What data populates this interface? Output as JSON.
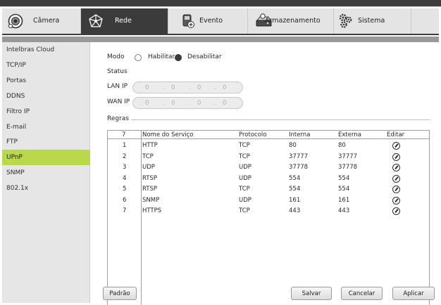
{
  "tabs": [
    {
      "label": "Câmera",
      "icon": "camera-icon"
    },
    {
      "label": "Rede",
      "icon": "network-icon",
      "active": true
    },
    {
      "label": "Evento",
      "icon": "event-icon"
    },
    {
      "label": "Armazenamento",
      "icon": "storage-icon"
    },
    {
      "label": "Sistema",
      "icon": "gears-icon"
    }
  ],
  "sidebar": {
    "items": [
      {
        "label": "Intelbras Cloud"
      },
      {
        "label": "TCP/IP"
      },
      {
        "label": "Portas"
      },
      {
        "label": "DDNS"
      },
      {
        "label": "Filtro IP"
      },
      {
        "label": "E-mail"
      },
      {
        "label": "FTP"
      },
      {
        "label": "UPnP",
        "active": true
      },
      {
        "label": "SNMP"
      },
      {
        "label": "802.1x"
      }
    ]
  },
  "form": {
    "mode_label": "Modo",
    "enable_label": "Habilitar",
    "disable_label": "Desabilitar",
    "selected_mode": "Desabilitar",
    "status_label": "Status",
    "lan_label": "LAN IP",
    "wan_label": "WAN IP",
    "lan_ip": [
      "0",
      "0",
      "0",
      "0"
    ],
    "wan_ip": [
      "0",
      "0",
      "0",
      "0"
    ],
    "ip_sep": ".",
    "rules_label": "Regras"
  },
  "table": {
    "headers": [
      "7",
      "Nome do Serviço",
      "Protocolo",
      "Interna",
      "Externa",
      "Editar"
    ],
    "rows": [
      [
        "1",
        "HTTP",
        "TCP",
        "80",
        "80"
      ],
      [
        "2",
        "TCP",
        "TCP",
        "37777",
        "37777"
      ],
      [
        "3",
        "UDP",
        "UDP",
        "37778",
        "37778"
      ],
      [
        "4",
        "RTSP",
        "UDP",
        "554",
        "554"
      ],
      [
        "5",
        "RTSP",
        "TCP",
        "554",
        "554"
      ],
      [
        "6",
        "SNMP",
        "UDP",
        "161",
        "161"
      ],
      [
        "7",
        "HTTPS",
        "TCP",
        "443",
        "443"
      ]
    ]
  },
  "buttons": {
    "default": "Padrão",
    "save": "Salvar",
    "cancel": "Cancelar",
    "apply": "Aplicar"
  },
  "colors": {
    "active_tab": "#3b3b3b",
    "active_sidebar": "#b7d94a"
  }
}
